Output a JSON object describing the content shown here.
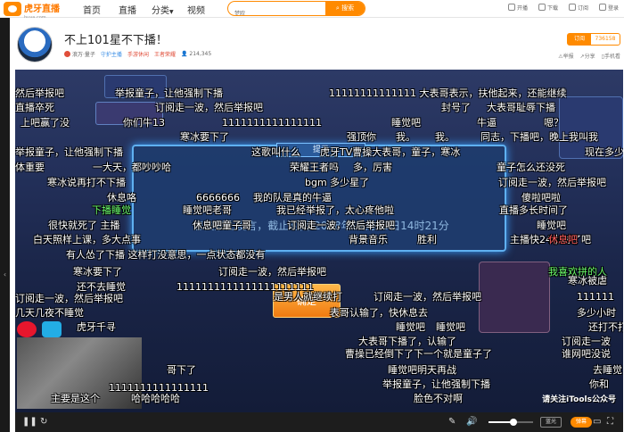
{
  "topbar": {
    "logo_text": "虎牙直播",
    "logo_sub": "huya.com",
    "nav": [
      "首页",
      "直播",
      "分类",
      "视频"
    ],
    "search_placeholder": "梦欧",
    "search_button": "搜索",
    "tools": [
      "开播",
      "下载",
      "订阅",
      "登录"
    ]
  },
  "header": {
    "title": "不上101星不下播！",
    "streamer": "浪万·量子",
    "badge": "守护主播",
    "category1": "手游休闲",
    "category2": "王者荣耀",
    "viewers": "214,345",
    "subscribe_label": "订阅",
    "subscribe_count": "736158",
    "actions": [
      "举报",
      "分享",
      "手机看"
    ]
  },
  "dialog": {
    "head": "提示",
    "message": "您被禁止发言，截止时间 2018年04月10日14时21分",
    "confirm": "确定"
  },
  "danmaku": [
    {
      "text": "然后举报吧",
      "c": ""
    },
    {
      "text": "举报童子，让他强制下播",
      "c": ""
    },
    {
      "text": "11111111111111 大表哥表示，扶他起来，还能继续",
      "c": ""
    },
    {
      "text": "直播卒死",
      "c": ""
    },
    {
      "text": "订阅走一波，然后举报吧",
      "c": ""
    },
    {
      "text": "封号了",
      "c": ""
    },
    {
      "text": "大表哥耻辱下播",
      "c": ""
    },
    {
      "text": "上吧赢了没",
      "c": ""
    },
    {
      "text": "你们牛13",
      "c": ""
    },
    {
      "text": "1111111111111111",
      "c": ""
    },
    {
      "text": "睡觉吧",
      "c": ""
    },
    {
      "text": "牛逼",
      "c": ""
    },
    {
      "text": "嗯？",
      "c": ""
    },
    {
      "text": "寒冰要下了",
      "c": ""
    },
    {
      "text": "强顶你",
      "c": ""
    },
    {
      "text": "我。",
      "c": ""
    },
    {
      "text": "我。",
      "c": ""
    },
    {
      "text": "同志，下播吧，晚上我叫我",
      "c": ""
    },
    {
      "text": "举报童子，让他强制下播",
      "c": ""
    },
    {
      "text": "这歌叫什么",
      "c": ""
    },
    {
      "text": "虎牙TV曹操大表哥，童子，寒冰",
      "c": ""
    },
    {
      "text": "现在多少星",
      "c": ""
    },
    {
      "text": "体重要",
      "c": ""
    },
    {
      "text": "一大天，都吵吵哈",
      "c": ""
    },
    {
      "text": "荣耀王者吗",
      "c": ""
    },
    {
      "text": "多，厉害",
      "c": ""
    },
    {
      "text": "童子怎么还没死",
      "c": ""
    },
    {
      "text": "寒冰说再打不下播",
      "c": ""
    },
    {
      "text": "bgm 多少星了",
      "c": ""
    },
    {
      "text": "订阅走一波，然后举报吧",
      "c": ""
    },
    {
      "text": "休息咯",
      "c": ""
    },
    {
      "text": "6666666",
      "c": ""
    },
    {
      "text": "我的队是真的牛逼",
      "c": ""
    },
    {
      "text": "傻啦吧啦",
      "c": ""
    },
    {
      "text": "下播睡觉",
      "c": "green"
    },
    {
      "text": "睡觉吧老哥",
      "c": ""
    },
    {
      "text": "我已经举报了，太心疼他啦",
      "c": ""
    },
    {
      "text": "直播多长时间了",
      "c": ""
    },
    {
      "text": "很快就死了 主播",
      "c": ""
    },
    {
      "text": "休息吧童子哥",
      "c": ""
    },
    {
      "text": "订阅走一波，然后举报吧",
      "c": ""
    },
    {
      "text": "睡觉吧",
      "c": ""
    },
    {
      "text": "白天照样上课，多大点事",
      "c": ""
    },
    {
      "text": "背景音乐",
      "c": ""
    },
    {
      "text": "胜利",
      "c": ""
    },
    {
      "text": "主播快24小时了吧",
      "c": ""
    },
    {
      "text": "休息吧",
      "c": "red"
    },
    {
      "text": "有人怂了下播 这样打没意思，一点状态都没有",
      "c": ""
    },
    {
      "text": "我喜欢拼的人",
      "c": "green"
    },
    {
      "text": "寒冰要下了",
      "c": ""
    },
    {
      "text": "订阅走一波，然后举报吧",
      "c": ""
    },
    {
      "text": "还不去睡觉",
      "c": ""
    },
    {
      "text": "1111111111111111111111",
      "c": ""
    },
    {
      "text": "寒冰被虐",
      "c": ""
    },
    {
      "text": "订阅走一波，然后举报吧",
      "c": ""
    },
    {
      "text": "是男人就继续打",
      "c": ""
    },
    {
      "text": "订阅走一波，然后举报吧",
      "c": ""
    },
    {
      "text": "111111",
      "c": ""
    },
    {
      "text": "几天几夜不睡觉",
      "c": ""
    },
    {
      "text": "表哥认输了，快休息去",
      "c": ""
    },
    {
      "text": "多少小时",
      "c": ""
    },
    {
      "text": "睡觉吧",
      "c": ""
    },
    {
      "text": "还打不打",
      "c": ""
    },
    {
      "text": "虎牙千寻",
      "c": ""
    },
    {
      "text": "订阅走一波",
      "c": ""
    },
    {
      "text": "大表哥下播了，认输了",
      "c": ""
    },
    {
      "text": "曹操已经倒下了下一个就是童子了",
      "c": ""
    },
    {
      "text": "谁网吧没说",
      "c": ""
    },
    {
      "text": "睡觉吧明天再战",
      "c": ""
    },
    {
      "text": "去睡觉",
      "c": ""
    },
    {
      "text": "举报童子，让他强制下播",
      "c": ""
    },
    {
      "text": "你和",
      "c": ""
    },
    {
      "text": "主要是这个",
      "c": ""
    },
    {
      "text": "哈哈哈哈哈",
      "c": ""
    },
    {
      "text": "脸色不对啊",
      "c": ""
    },
    {
      "text": "1111111111111111",
      "c": ""
    },
    {
      "text": "睡觉吧",
      "c": ""
    },
    {
      "text": "哥下了",
      "c": ""
    }
  ],
  "overlay": {
    "follow_tip": "请关注iTools公众号"
  },
  "controls": {
    "quality": "蓝光",
    "danmaku_toggle": "弹幕",
    "volume": 0.55
  }
}
